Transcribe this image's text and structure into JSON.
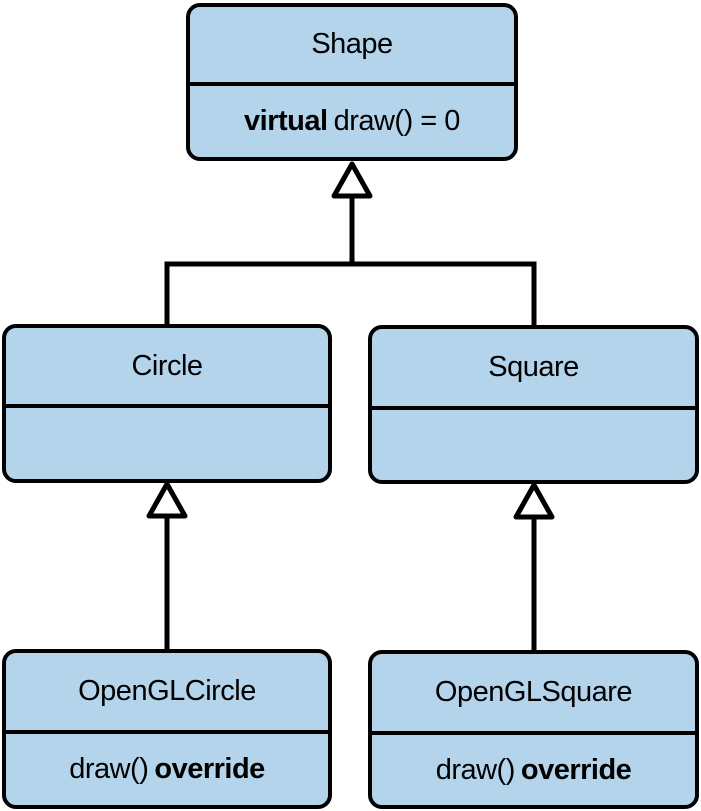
{
  "diagram": {
    "type": "UML class hierarchy",
    "colors": {
      "box_fill": "#b3d4ea",
      "stroke": "#000000",
      "background": "#ffffff"
    },
    "classes": {
      "shape": {
        "name": "Shape",
        "ops_keyword_before": "virtual",
        "ops_text": "draw() = 0"
      },
      "circle": {
        "name": "Circle"
      },
      "square": {
        "name": "Square"
      },
      "opengl_circle": {
        "name": "OpenGLCircle",
        "ops_text": "draw()",
        "ops_keyword_after": "override"
      },
      "opengl_square": {
        "name": "OpenGLSquare",
        "ops_text": "draw()",
        "ops_keyword_after": "override"
      }
    },
    "relationships": [
      {
        "from": "Circle",
        "to": "Shape",
        "kind": "inheritance"
      },
      {
        "from": "Square",
        "to": "Shape",
        "kind": "inheritance"
      },
      {
        "from": "OpenGLCircle",
        "to": "Circle",
        "kind": "inheritance"
      },
      {
        "from": "OpenGLSquare",
        "to": "Square",
        "kind": "inheritance"
      }
    ]
  }
}
